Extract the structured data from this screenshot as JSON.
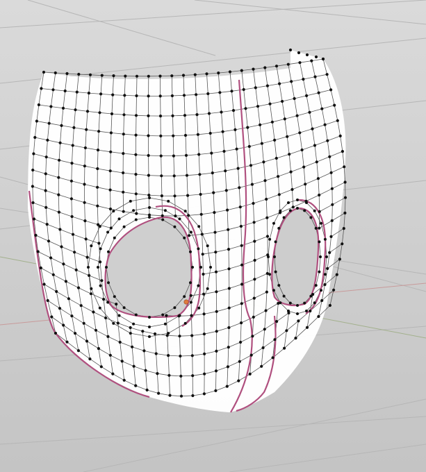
{
  "viewport": {
    "kind": "3d-viewport",
    "background_top": "#d9d9d9",
    "background_bottom": "#c6c6c6",
    "grid_color": "#b5b5b5",
    "axis_x_color": "#c89a9a",
    "axis_y_color": "#9fb088"
  },
  "mesh": {
    "object": "mask",
    "mode": "edit",
    "face_color": "#ffffff",
    "edge_color": "#555555",
    "vertex_color": "#111111",
    "seam_color": "#b0507f",
    "edge_rings": 16,
    "edge_loops": 24,
    "eye_holes": 2,
    "pivot_color": "#e07a3e"
  }
}
